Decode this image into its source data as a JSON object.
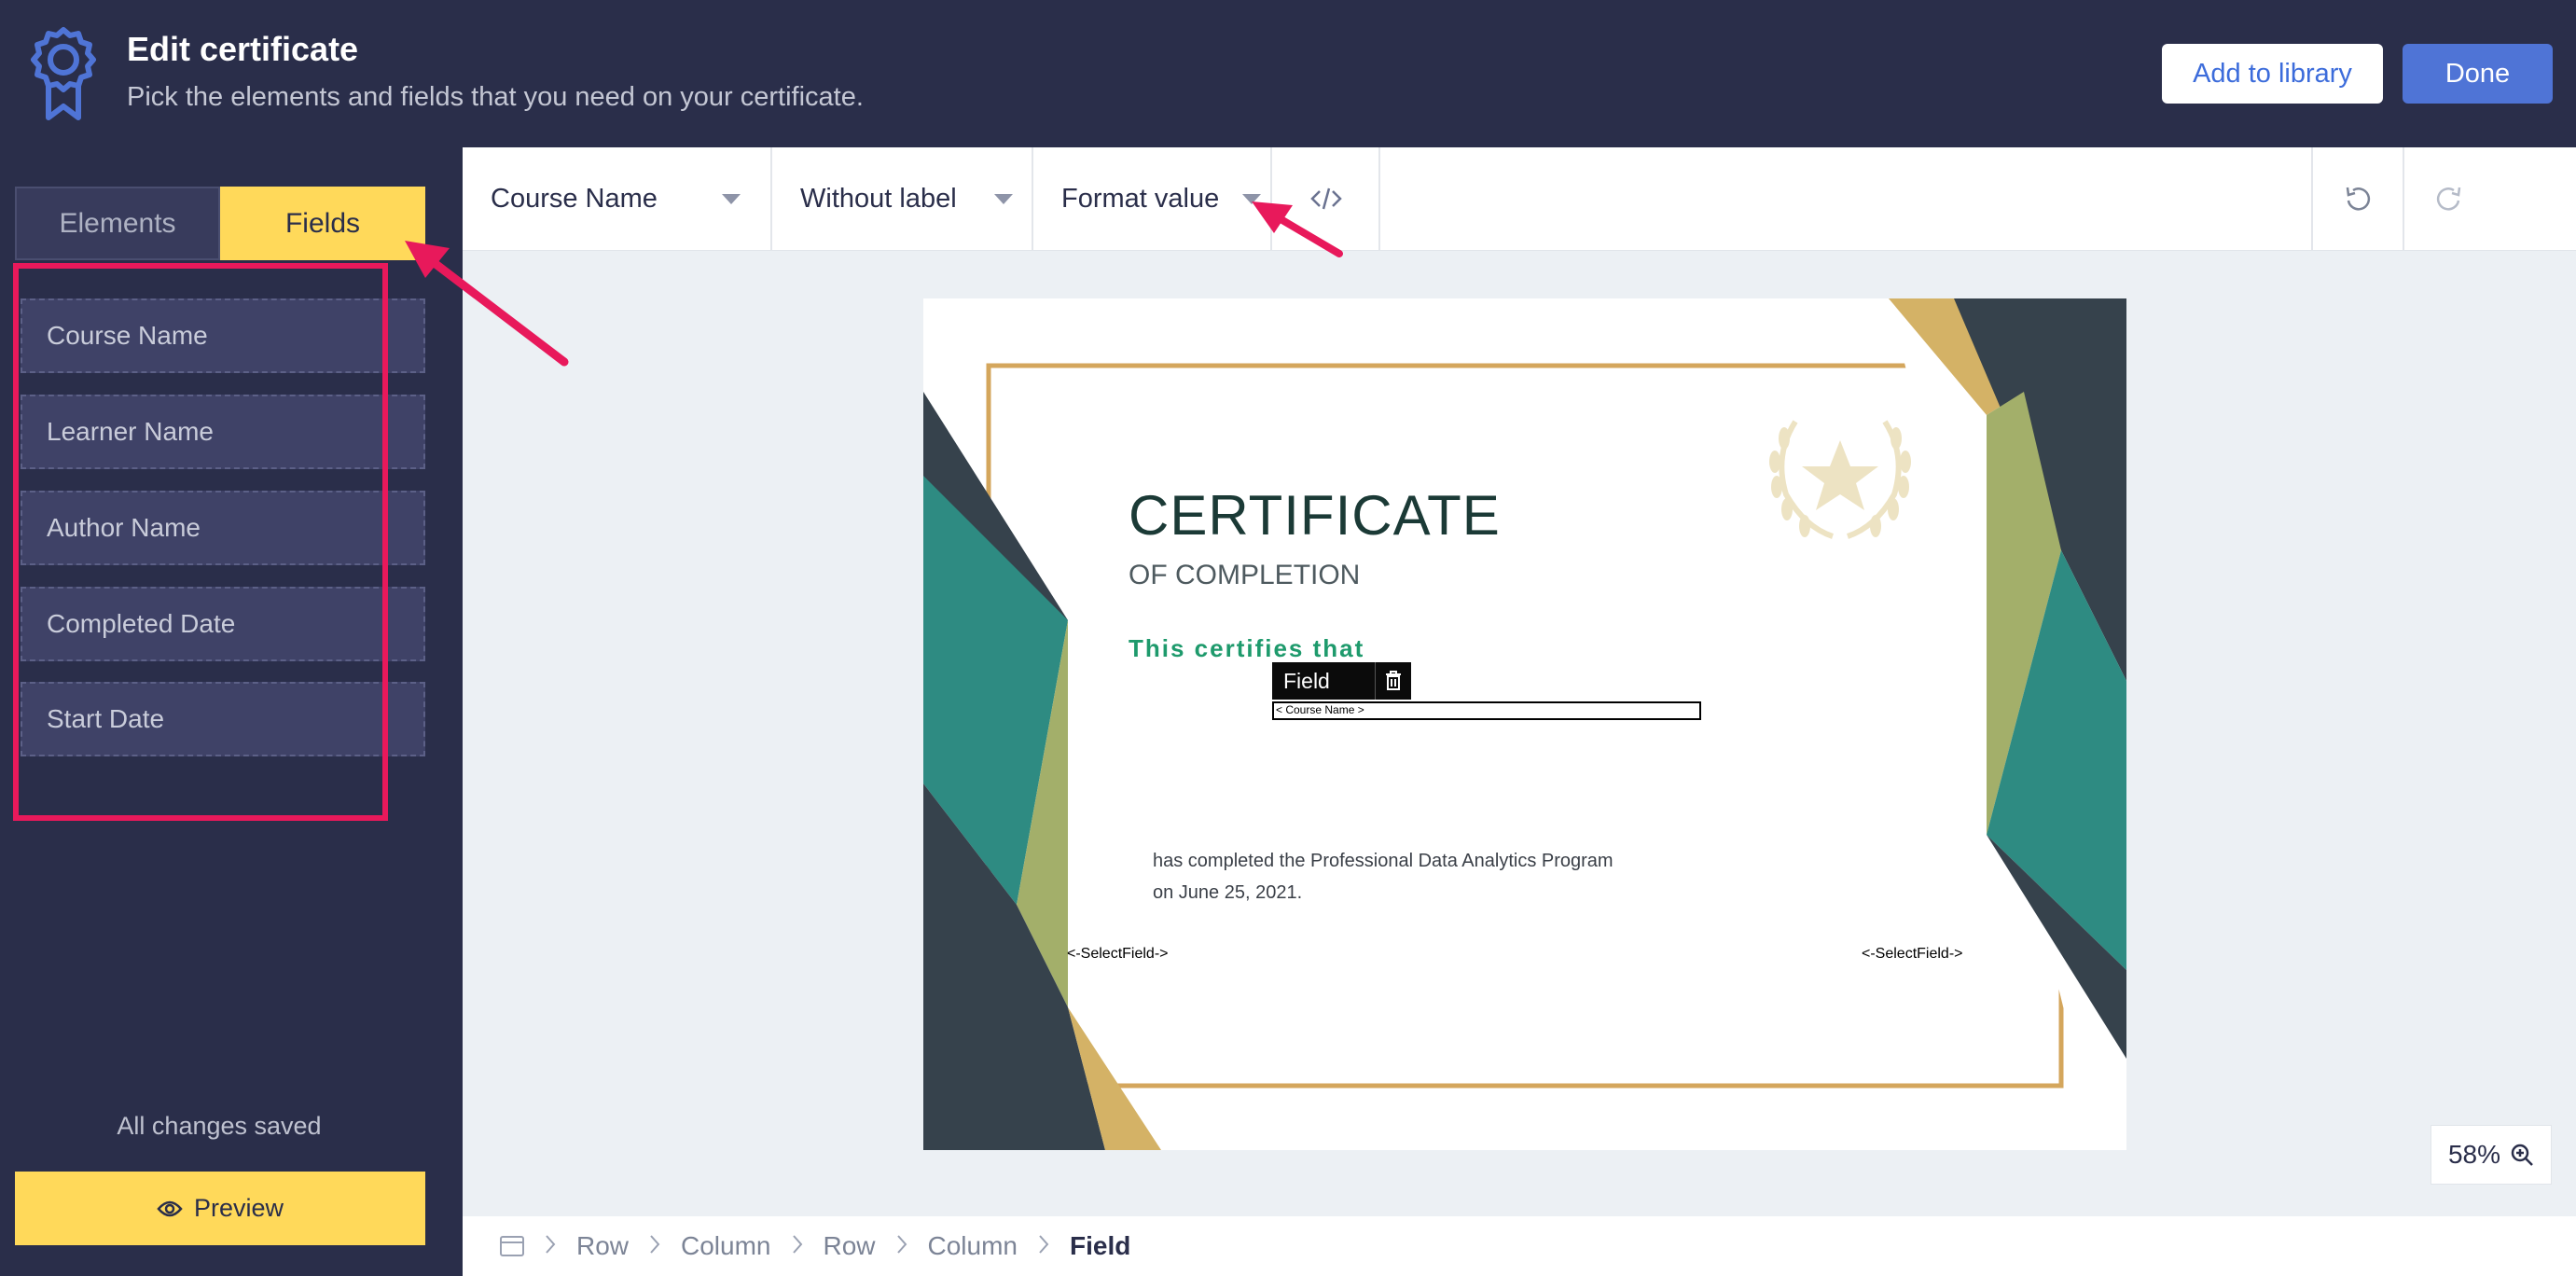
{
  "header": {
    "title": "Edit certificate",
    "subtitle": "Pick the elements and fields that you need on your certificate.",
    "add_to_library_label": "Add to library",
    "done_label": "Done",
    "logo_icon": "award-badge-icon"
  },
  "sidebar": {
    "tabs": [
      {
        "label": "Elements",
        "active": false
      },
      {
        "label": "Fields",
        "active": true
      }
    ],
    "fields": [
      "Course Name",
      "Learner Name",
      "Author Name",
      "Completed Date",
      "Start Date"
    ],
    "status": "All changes saved",
    "preview_label": "Preview"
  },
  "toolbar": {
    "field_select": "Course Name",
    "label_select": "Without label",
    "format_select": "Format value",
    "code_icon": "code-icon",
    "undo_icon": "undo-icon",
    "redo_icon": "redo-icon"
  },
  "certificate": {
    "heading": "CERTIFICATE",
    "subheading": "OF COMPLETION",
    "certifies": "This certifies that",
    "field_tag": "Field",
    "field_placeholder": "< Course Name >",
    "body_line1": "has completed the Professional Data Analytics Program",
    "body_line2": "on June 25, 2021.",
    "select_field_left": "<-SelectField->",
    "select_field_right": "<-SelectField->"
  },
  "zoom": {
    "level": "58%"
  },
  "breadcrumb": [
    "Row",
    "Column",
    "Row",
    "Column",
    "Field"
  ],
  "colors": {
    "header_bg": "#2A2E4A",
    "accent_yellow": "#FFD95A",
    "primary_blue": "#4F74D6",
    "annotation_red": "#E8195B",
    "cert_gold": "#D4B266",
    "cert_teal": "#2E8B82",
    "cert_dark": "#36424C"
  }
}
